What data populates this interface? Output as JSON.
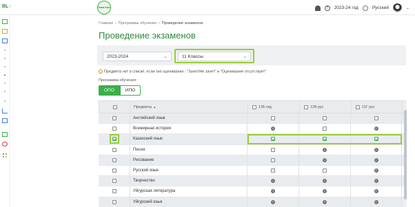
{
  "topbar": {
    "app_short": "BL",
    "logo_text": "Gaia Kaz",
    "academic_year": "2023-24 год",
    "language": "Русский"
  },
  "breadcrumb": {
    "home": "Главная",
    "programs": "Программы обучения",
    "current": "Проведение экзаменов"
  },
  "page_title": "Проведение экзаменов",
  "filters": {
    "year": "2023-2024",
    "class": "11 Классы"
  },
  "warning_text": "Предмета нет в списке, если тип оценивания - \"Зачет/Не зачет\" и \"Оценивание отсутствует\"",
  "program_label": "Программа обучения:",
  "program_toggle": [
    "ОПО",
    "ИПО"
  ],
  "table": {
    "header_subjects": "Предметы",
    "sort_icon": "▲",
    "columns": [
      "11Б гед",
      "11В рус",
      "11Г рус"
    ],
    "rows": [
      {
        "name": "Английский язык",
        "checked": false,
        "cells": [
          "check",
          "check",
          "check"
        ]
      },
      {
        "name": "Всемирная история",
        "checked": false,
        "cells": [
          "info",
          "check",
          "info"
        ]
      },
      {
        "name": "Казахский язык",
        "checked": true,
        "cells": [
          "checked",
          "checked",
          "checked"
        ]
      },
      {
        "name": "Песня",
        "checked": false,
        "cells": [
          "check",
          "info",
          "info"
        ]
      },
      {
        "name": "Рисование",
        "checked": false,
        "cells": [
          "check",
          "info",
          "info"
        ]
      },
      {
        "name": "Русский язык",
        "checked": false,
        "cells": [
          "check",
          "check",
          "info"
        ]
      },
      {
        "name": "Творчество",
        "checked": false,
        "cells": [
          "info",
          "info",
          "info"
        ]
      },
      {
        "name": "Уйгурская литература",
        "checked": false,
        "cells": [
          "info",
          "info",
          "info"
        ]
      },
      {
        "name": "Уйгурский язык",
        "checked": false,
        "cells": [
          "info",
          "info",
          "info"
        ]
      }
    ]
  }
}
